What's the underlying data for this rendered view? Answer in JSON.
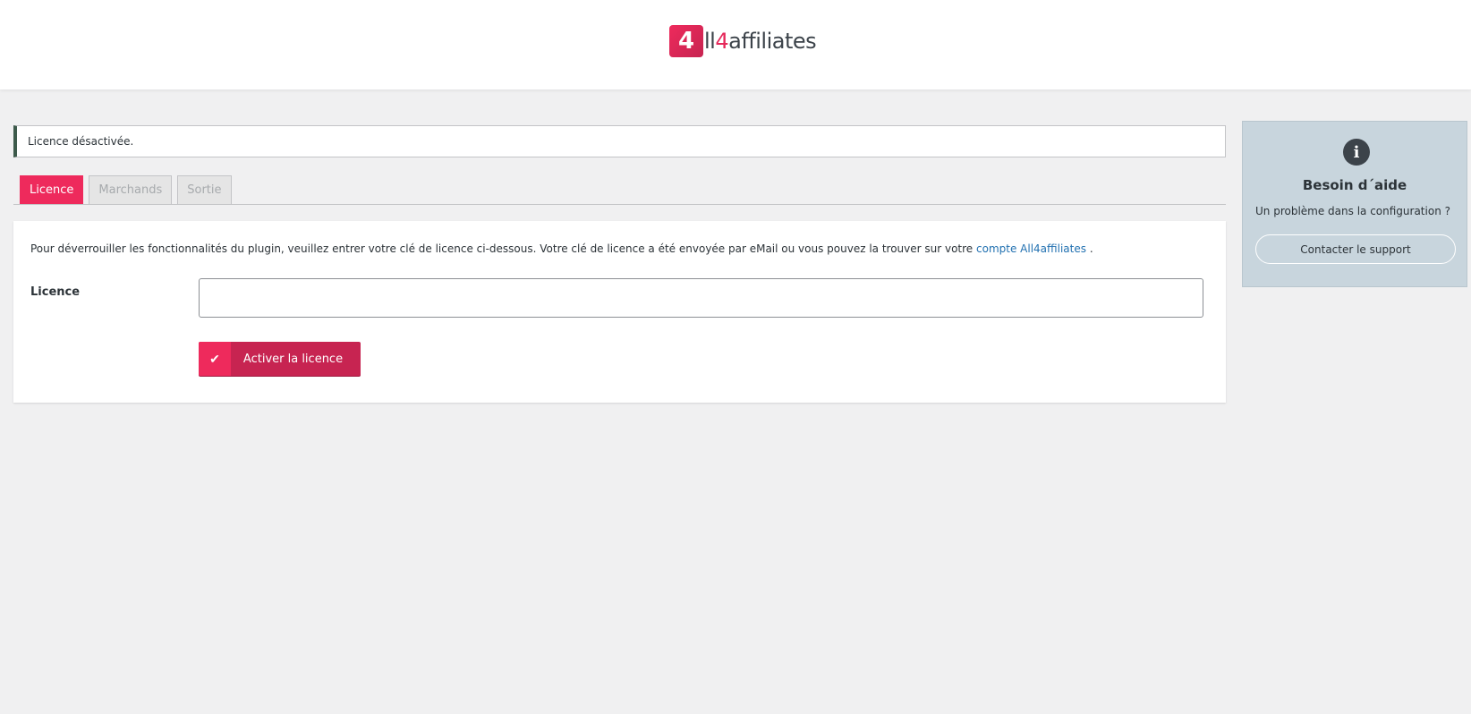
{
  "header": {
    "logo_mark": "4",
    "logo_text_pre": "ll",
    "logo_text_accent": "4",
    "logo_text_post": "affiliates"
  },
  "notice": {
    "text": "Licence désactivée."
  },
  "tabs": [
    {
      "label": "Licence",
      "active": true
    },
    {
      "label": "Marchands",
      "active": false
    },
    {
      "label": "Sortie",
      "active": false
    }
  ],
  "licence_form": {
    "intro_text": "Pour déverrouiller les fonctionnalités du plugin, veuillez entrer votre clé de licence ci-dessous. Votre clé de licence a été envoyée par eMail ou vous pouvez la trouver sur votre ",
    "intro_link": "compte All4affiliates",
    "intro_suffix": " .",
    "field_label": "Licence",
    "field_value": "",
    "button_icon": "check-icon",
    "button_label": "Activer la licence"
  },
  "help": {
    "icon": "info-icon",
    "title": "Besoin d´aide",
    "text": "Un problème dans la configuration ?",
    "button_label": "Contacter le support"
  },
  "colors": {
    "accent": "#ee2a5c",
    "accent_dark": "#c72451",
    "notice_border": "#3d5a4b",
    "help_bg": "#c8d5dd",
    "link": "#2271b1"
  }
}
